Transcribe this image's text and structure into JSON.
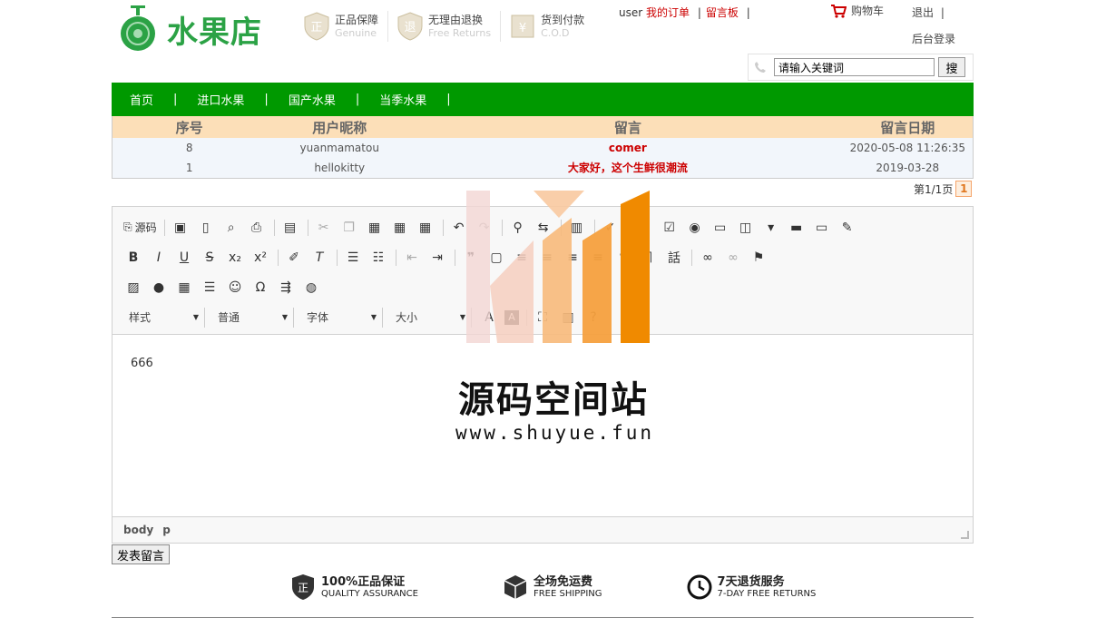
{
  "brand": {
    "name": "水果店",
    "color": "#2ba245"
  },
  "badges": [
    {
      "cn": "正品保障",
      "en": "Genuine"
    },
    {
      "cn": "无理由退换",
      "en": "Free Returns"
    },
    {
      "cn": "货到付款",
      "en": "C.O.D"
    }
  ],
  "topnav": {
    "user": "user",
    "my_orders": "我的订单",
    "sep1": "|",
    "message_board": "留言板",
    "sep2": "|",
    "cart": "购物车",
    "logout": "退出",
    "sep3": "|",
    "admin_login": "后台登录"
  },
  "search": {
    "value": "请输入关键词",
    "button": "搜"
  },
  "mainnav": {
    "items": [
      "首页",
      "进口水果",
      "国产水果",
      "当季水果"
    ],
    "sep": "|",
    "color": "#009900"
  },
  "messages": {
    "headers": [
      "序号",
      "用户昵称",
      "留言",
      "留言日期"
    ],
    "rows": [
      [
        "8",
        "yuanmamatou",
        "comer",
        "2020-05-08 11:26:35"
      ],
      [
        "1",
        "hellokitty",
        "大家好，这个生鲜很潮流",
        "2019-03-28"
      ]
    ],
    "pager": {
      "text": "第1/1页",
      "current": "1"
    }
  },
  "editor": {
    "source_label": "源码",
    "combos": [
      "样式",
      "普通",
      "字体",
      "大小"
    ],
    "content": "666",
    "path": [
      "body",
      "p"
    ]
  },
  "submit_label": "发表留言",
  "services": [
    {
      "cn": "100%正品保证",
      "en": "QUALITY ASSURANCE"
    },
    {
      "cn": "全场免运费",
      "en": "FREE SHIPPING"
    },
    {
      "cn": "7天退货服务",
      "en": "7-DAY FREE RETURNS"
    }
  ],
  "watermark": {
    "title": "源码空间站",
    "url": "www.shuyue.fun"
  }
}
